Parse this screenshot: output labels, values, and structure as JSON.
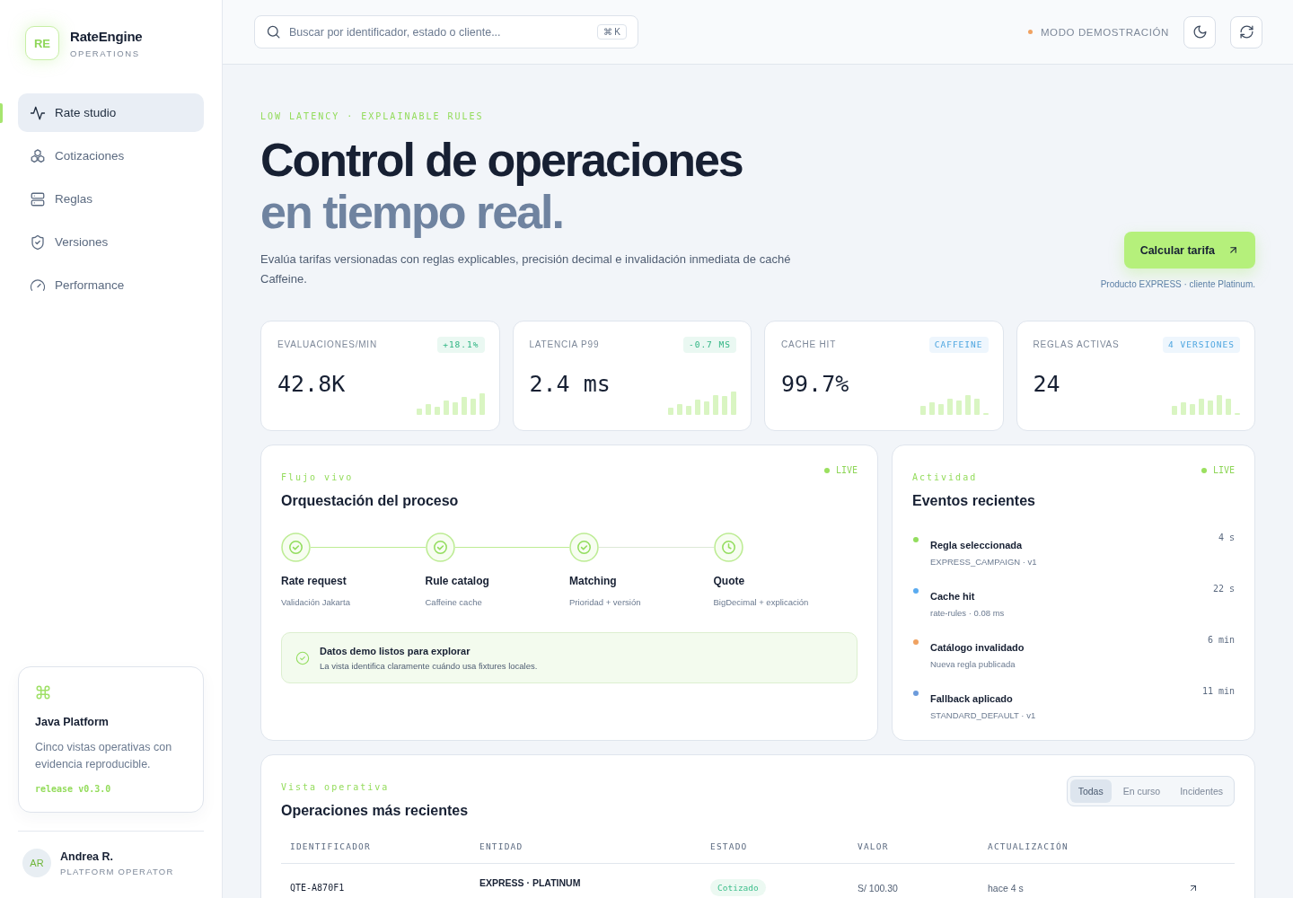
{
  "sidebar": {
    "brand": {
      "logo": "RE",
      "name": "RateEngine",
      "subtitle": "OPERATIONS"
    },
    "nav": [
      {
        "label": "Rate studio",
        "selected": true
      },
      {
        "label": "Cotizaciones",
        "selected": false
      },
      {
        "label": "Reglas",
        "selected": false
      },
      {
        "label": "Versiones",
        "selected": false
      },
      {
        "label": "Performance",
        "selected": false
      }
    ],
    "promo": {
      "title": "Java Platform",
      "text": "Cinco vistas operativas con evidencia reproducible.",
      "tag": "release v0.3.0"
    },
    "user": {
      "initials": "AR",
      "name": "Andrea R.",
      "role": "PLATFORM OPERATOR"
    }
  },
  "topbar": {
    "search": {
      "placeholder": "Buscar por identificador, estado o cliente...",
      "shortcut": "⌘ K"
    },
    "mode": "MODO DEMOSTRACIÓN"
  },
  "hero": {
    "eyebrow": "LOW LATENCY · EXPLAINABLE RULES",
    "title": "Control de operaciones",
    "title_accent": "en tiempo real.",
    "description": "Evalúa tarifas versionadas con reglas explicables, precisión decimal e invalidación inmediata de caché Caffeine.",
    "cta": "Calcular tarifa",
    "cta_note": "Producto EXPRESS · cliente Platinum."
  },
  "kpis": [
    {
      "label": "EVALUACIONES/MIN",
      "badge": "+18.1%",
      "kind": "delta",
      "value": "42.8K"
    },
    {
      "label": "LATENCIA P99",
      "badge": "-0.7 MS",
      "kind": "delta",
      "value": "2.4 ms"
    },
    {
      "label": "CACHE HIT",
      "badge": "CAFFEINE",
      "kind": "info",
      "value": "99.7%"
    },
    {
      "label": "REGLAS ACTIVAS",
      "badge": "4 VERSIONES",
      "kind": "info",
      "value": "24"
    }
  ],
  "process": {
    "eyebrow": "Flujo vivo",
    "status": "LIVE",
    "title": "Orquestación del proceso",
    "steps": [
      {
        "title": "Rate request",
        "detail": "Validación Jakarta",
        "done": true
      },
      {
        "title": "Rule catalog",
        "detail": "Caffeine cache",
        "done": true
      },
      {
        "title": "Matching",
        "detail": "Prioridad + versión",
        "done": true
      },
      {
        "title": "Quote",
        "detail": "BigDecimal + explicación",
        "done": false
      }
    ],
    "notice": {
      "title": "Datos demo listos para explorar",
      "text": "La vista identifica claramente cuándo usa fixtures locales."
    }
  },
  "events": {
    "eyebrow": "Actividad",
    "status": "LIVE",
    "title": "Eventos recientes",
    "items": [
      {
        "title": "Regla seleccionada",
        "detail": "EXPRESS_CAMPAIGN · v1",
        "time": "4 s",
        "color": "#93dd5e"
      },
      {
        "title": "Cache hit",
        "detail": "rate-rules · 0.08 ms",
        "time": "22 s",
        "color": "#5aabf0"
      },
      {
        "title": "Catálogo invalidado",
        "detail": "Nueva regla publicada",
        "time": "6 min",
        "color": "#f0a261"
      },
      {
        "title": "Fallback aplicado",
        "detail": "STANDARD_DEFAULT · v1",
        "time": "11 min",
        "color": "#6c9bdb"
      }
    ]
  },
  "operations": {
    "eyebrow": "Vista operativa",
    "title": "Operaciones más recientes",
    "filters": [
      {
        "label": "Todas",
        "selected": true
      },
      {
        "label": "En curso",
        "selected": false
      },
      {
        "label": "Incidentes",
        "selected": false
      }
    ],
    "columns": [
      "IDENTIFICADOR",
      "ENTIDAD",
      "ESTADO",
      "VALOR",
      "ACTUALIZACIÓN"
    ],
    "rows": [
      {
        "id": "QTE-A870F1",
        "entity": "EXPRESS · PLATINUM",
        "status": "Cotizado",
        "value": "S/ 100.30",
        "updated": "hace 4 s"
      }
    ]
  }
}
